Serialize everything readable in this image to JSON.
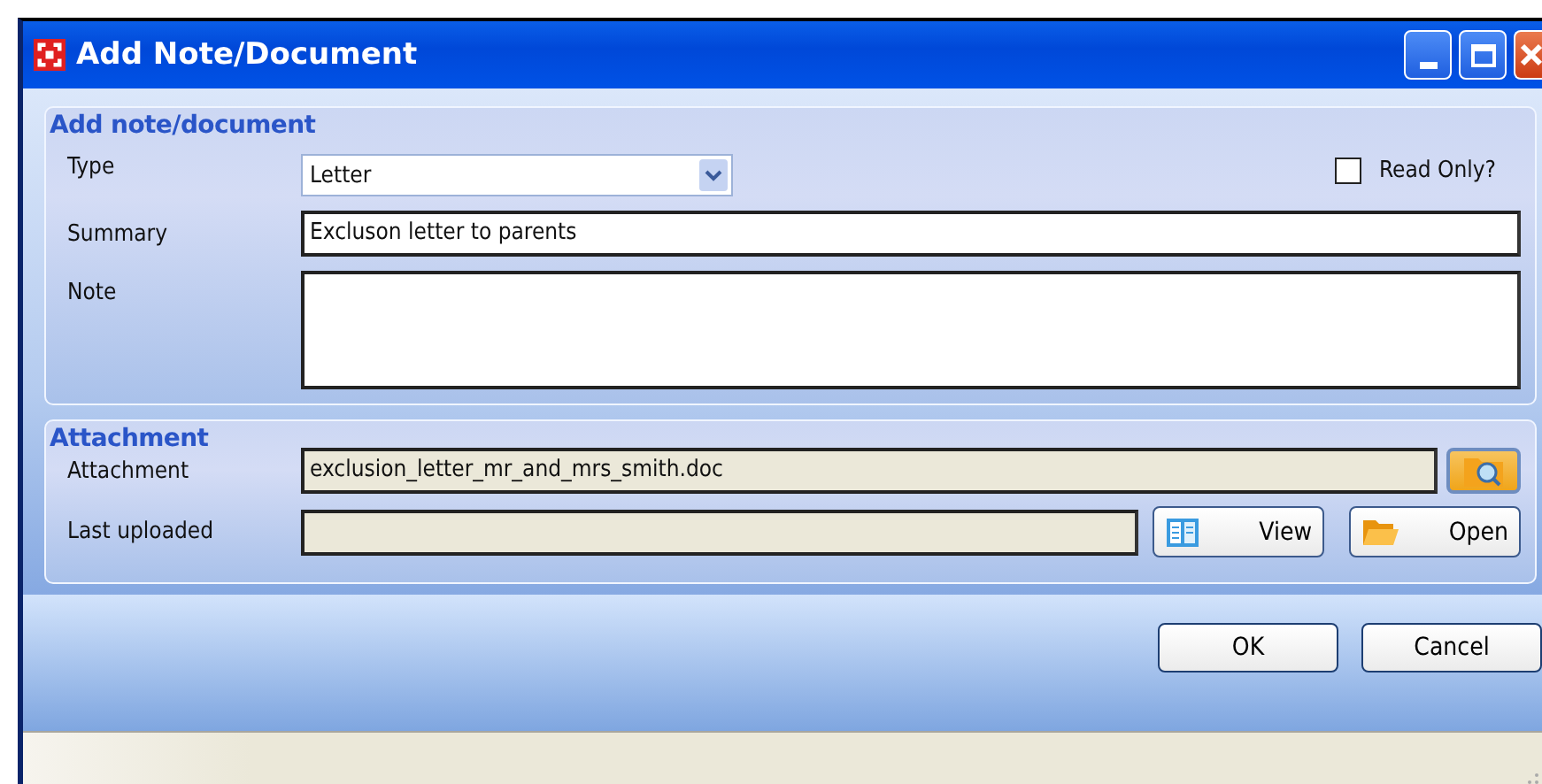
{
  "window": {
    "title": "Add Note/Document"
  },
  "note_group": {
    "heading": "Add note/document",
    "type": {
      "label": "Type",
      "value": "Letter"
    },
    "read_only": {
      "label": "Read Only?",
      "checked": false
    },
    "summary": {
      "label": "Summary",
      "value": "Excluson letter to parents"
    },
    "note": {
      "label": "Note"
    }
  },
  "attachment_group": {
    "heading": "Attachment",
    "attachment": {
      "label": "Attachment",
      "value": "exclusion_letter_mr_and_mrs_smith.doc"
    },
    "last_uploaded": {
      "label": "Last uploaded"
    },
    "buttons": [
      {
        "label": "View",
        "kind": "view"
      },
      {
        "label": "Open",
        "kind": "open"
      }
    ]
  },
  "buttons": [
    "OK",
    "Cancel"
  ]
}
